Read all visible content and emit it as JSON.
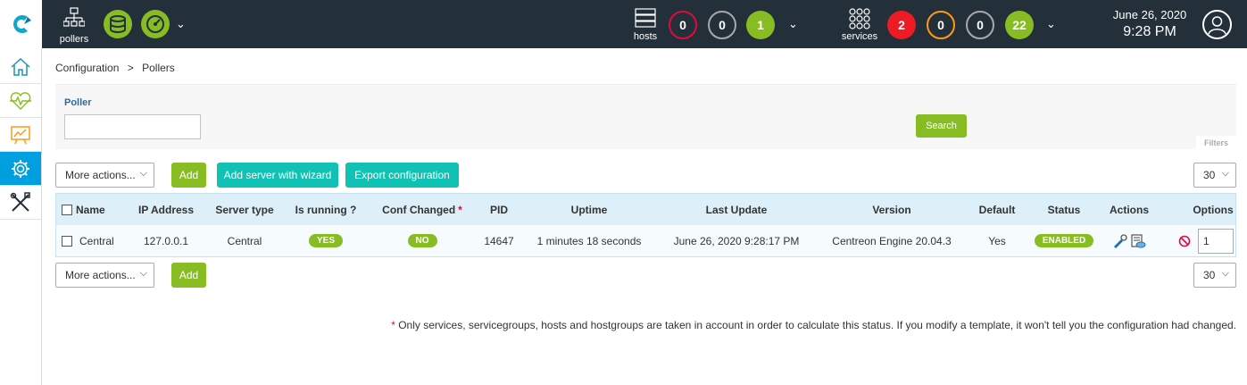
{
  "header": {
    "pollers_label": "pollers",
    "hosts_label": "hosts",
    "hosts_counts": [
      "0",
      "0",
      "1"
    ],
    "services_label": "services",
    "services_counts": [
      "2",
      "0",
      "0",
      "22"
    ],
    "date": "June 26, 2020",
    "time": "9:28 PM"
  },
  "sidebar": {
    "items": [
      {
        "icon": "home-icon"
      },
      {
        "icon": "monitoring-heart-icon"
      },
      {
        "icon": "reporting-chart-icon"
      },
      {
        "icon": "gear-icon",
        "active": true
      },
      {
        "icon": "tools-icon"
      }
    ]
  },
  "breadcrumb": {
    "part1": "Configuration",
    "sep": ">",
    "part2": "Pollers"
  },
  "filters": {
    "poller_label": "Poller",
    "poller_value": "",
    "search_label": "Search",
    "filters_tab": "Filters"
  },
  "toolbar": {
    "more_actions": "More actions...",
    "add": "Add",
    "add_wizard": "Add server with wizard",
    "export": "Export configuration",
    "page_size": "30"
  },
  "table": {
    "headers": {
      "name": "Name",
      "ip": "IP Address",
      "server_type": "Server type",
      "is_running": "Is running ?",
      "conf_changed": "Conf Changed",
      "conf_changed_star": "*",
      "pid": "PID",
      "uptime": "Uptime",
      "last_update": "Last Update",
      "version": "Version",
      "default": "Default",
      "status": "Status",
      "actions": "Actions",
      "options": "Options"
    },
    "rows": [
      {
        "name": "Central",
        "ip": "127.0.0.1",
        "server_type": "Central",
        "is_running": "YES",
        "conf_changed": "NO",
        "pid": "14647",
        "uptime": "1 minutes 18 seconds",
        "last_update": "June 26, 2020 9:28:17 PM",
        "version": "Centreon Engine 20.04.3",
        "default": "Yes",
        "status": "ENABLED",
        "option_value": "1"
      }
    ]
  },
  "footnote": {
    "star": "*",
    "text": " Only services, servicegroups, hosts and hostgroups are taken in account in order to calculate this status. If you modify a template, it won't tell you the configuration had changed."
  },
  "colors": {
    "header_bg": "#232f39",
    "green": "#87bd23",
    "teal": "#10c2b4",
    "active_nav": "#009fdf",
    "critical_red": "#ed1b24"
  }
}
